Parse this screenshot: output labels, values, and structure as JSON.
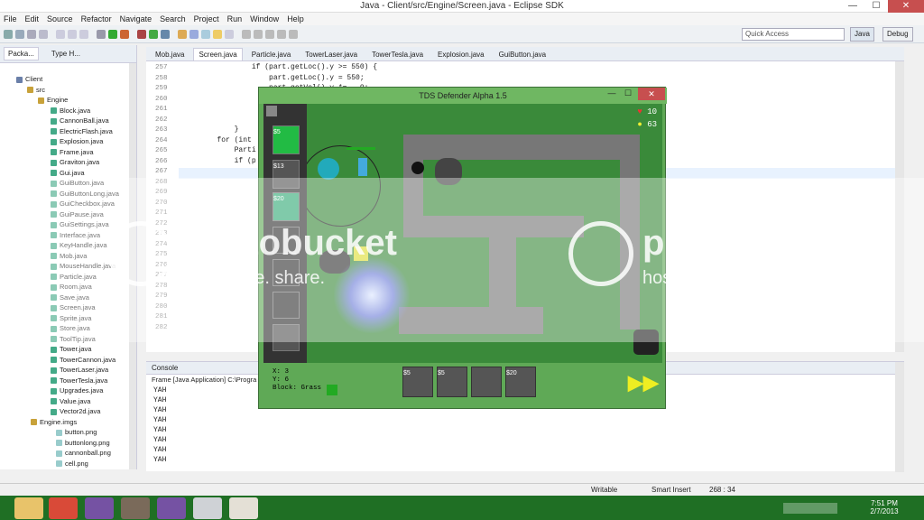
{
  "window": {
    "title": "Java - Client/src/Engine/Screen.java - Eclipse SDK",
    "min": "—",
    "max": "☐",
    "close": "✕"
  },
  "menu": [
    "File",
    "Edit",
    "Source",
    "Refactor",
    "Navigate",
    "Search",
    "Project",
    "Run",
    "Window",
    "Help"
  ],
  "toolbar": {
    "quick_access": "Quick Access",
    "perspective_java": "Java",
    "perspective_debug": "Debug"
  },
  "package_explorer": {
    "tab1": "Packa...",
    "tab2": "Type H...",
    "items": [
      "Client",
      "src",
      "Engine",
      "Block.java",
      "CannonBall.java",
      "ElectricFlash.java",
      "Explosion.java",
      "Frame.java",
      "Graviton.java",
      "Gui.java",
      "GuiButton.java",
      "GuiButtonLong.java",
      "GuiCheckbox.java",
      "GuiPause.java",
      "GuiSettings.java",
      "Interface.java",
      "KeyHandle.java",
      "Mob.java",
      "MouseHandle.java",
      "Particle.java",
      "Room.java",
      "Save.java",
      "Screen.java",
      "Sprite.java",
      "Store.java",
      "ToolTip.java",
      "Tower.java",
      "TowerCannon.java",
      "TowerLaser.java",
      "TowerTesla.java",
      "Upgrades.java",
      "Value.java",
      "Vector2d.java",
      "Engine.imgs",
      "button.png",
      "buttonlong.png",
      "cannonball.png",
      "cell.png"
    ]
  },
  "editor": {
    "tabs": [
      "Mob.java",
      "Screen.java",
      "Particle.java",
      "TowerLaser.java",
      "TowerTesla.java",
      "Explosion.java",
      "GuiButton.java"
    ],
    "line_numbers": [
      "257",
      "258",
      "259",
      "260",
      "261",
      "262",
      "263",
      "264",
      "265",
      "266",
      "267",
      "268",
      "269",
      "270",
      "271",
      "272",
      "273",
      "274",
      "275",
      "276",
      "277",
      "278",
      "279",
      "280",
      "281",
      "282"
    ],
    "code": [
      {
        "ln": "257",
        "text": "                if (part.getLoc().y >= 550) {"
      },
      {
        "ln": "258",
        "text": "                    part.getLoc().y = 550;"
      },
      {
        "ln": "259",
        "text": "                    part.getVel().y *= -.9;"
      },
      {
        "ln": "263",
        "text": "            }"
      },
      {
        "ln": "264",
        "text": "        for (int"
      },
      {
        "ln": "265",
        "text": "            Parti"
      },
      {
        "ln": "266",
        "text": "            if (p"
      }
    ]
  },
  "console": {
    "tab": "Console",
    "header": "Frame [Java Application] C:\\Progra",
    "lines": [
      "YAH",
      "YAH",
      "YAH",
      "YAH",
      "YAH",
      "YAH",
      "YAH",
      "YAH"
    ]
  },
  "status": {
    "writable": "Writable",
    "insert": "Smart Insert",
    "position": "268 : 34"
  },
  "taskbar": {
    "time": "7:51 PM",
    "date": "2/7/2013"
  },
  "watermark": {
    "left": "photobucket",
    "left_sub": "host. store. share.",
    "right": "photobucket",
    "right_sub": "host. store. share."
  },
  "game": {
    "title": "TDS Defender Alpha 1.5",
    "lives": "10",
    "money": "63",
    "towers": [
      {
        "price": "$5"
      },
      {
        "price": "$13"
      },
      {
        "price": "$20"
      }
    ],
    "info": {
      "x": "X: 3",
      "y": "Y: 6",
      "block": "Block: Grass"
    },
    "bottom_buttons": [
      {
        "price": "$5"
      },
      {
        "price": "$5"
      },
      {
        "price": ""
      },
      {
        "price": "$20"
      }
    ],
    "fast_forward": "▶▶"
  },
  "colors": {
    "grass": "#5fa956",
    "dark_grass": "#3a8a3a",
    "brick": "#777777",
    "sidebar": "#333333",
    "taskbar": "#1f6f24",
    "close": "#c74f4f"
  }
}
